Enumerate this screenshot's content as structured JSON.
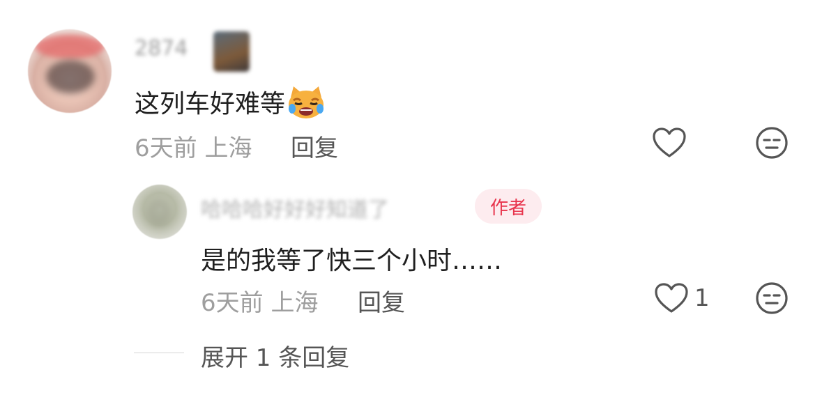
{
  "main_comment": {
    "username": "2874",
    "text": "这列车好难等",
    "emoji_icon": "crying-cat-face-emoji",
    "time": "6天前",
    "location": "上海",
    "reply_label": "回复"
  },
  "reply_comment": {
    "username": "哈哈哈好好好知道了",
    "author_badge": "作者",
    "text": "是的我等了快三个小时……",
    "time": "6天前",
    "location": "上海",
    "reply_label": "回复",
    "like_count": "1"
  },
  "expand": {
    "label": "展开 1 条回复"
  },
  "icons": {
    "like": "heart-outline-icon",
    "dislike": "neutral-face-icon"
  },
  "colors": {
    "author_badge_bg": "#fdecef",
    "author_badge_text": "#e8344c",
    "meta_text": "#9e9e9e",
    "action_text": "#555555"
  }
}
